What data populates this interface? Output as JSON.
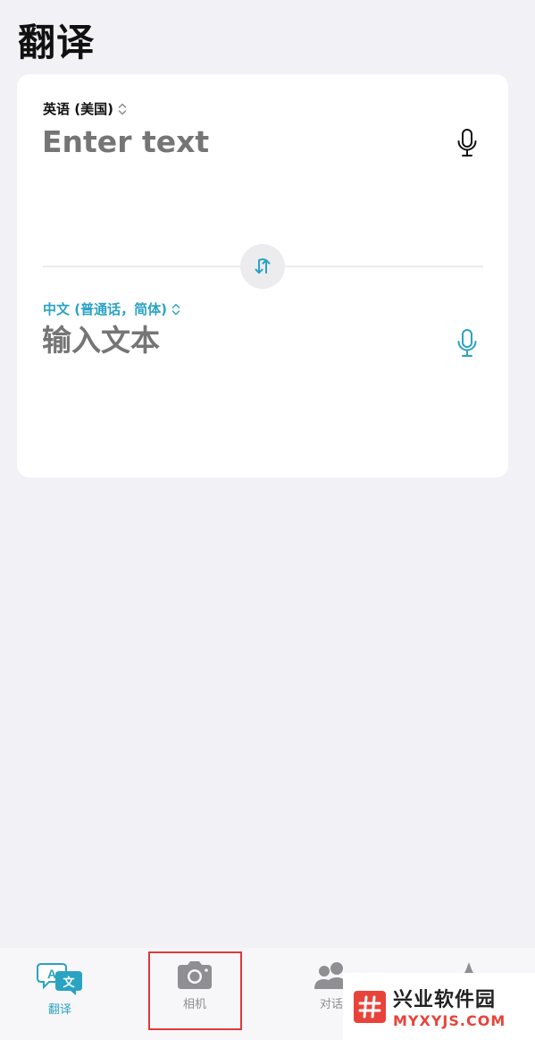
{
  "header": {
    "title": "翻译"
  },
  "source": {
    "language": "英语 (美国)",
    "placeholder": "Enter text"
  },
  "target": {
    "language": "中文 (普通话，简体)",
    "placeholder": "输入文本"
  },
  "tabs": [
    {
      "label": "翻译",
      "icon": "translate-icon",
      "active": true
    },
    {
      "label": "相机",
      "icon": "camera-icon",
      "active": false
    },
    {
      "label": "对话",
      "icon": "conversation-icon",
      "active": false
    }
  ],
  "watermark": {
    "title": "兴业软件园",
    "subtitle": "MYXYJS.COM"
  },
  "colors": {
    "accent": "#2aa3c3",
    "background": "#f2f1f6",
    "highlight": "#e0383a",
    "watermark_red": "#e8433a"
  }
}
